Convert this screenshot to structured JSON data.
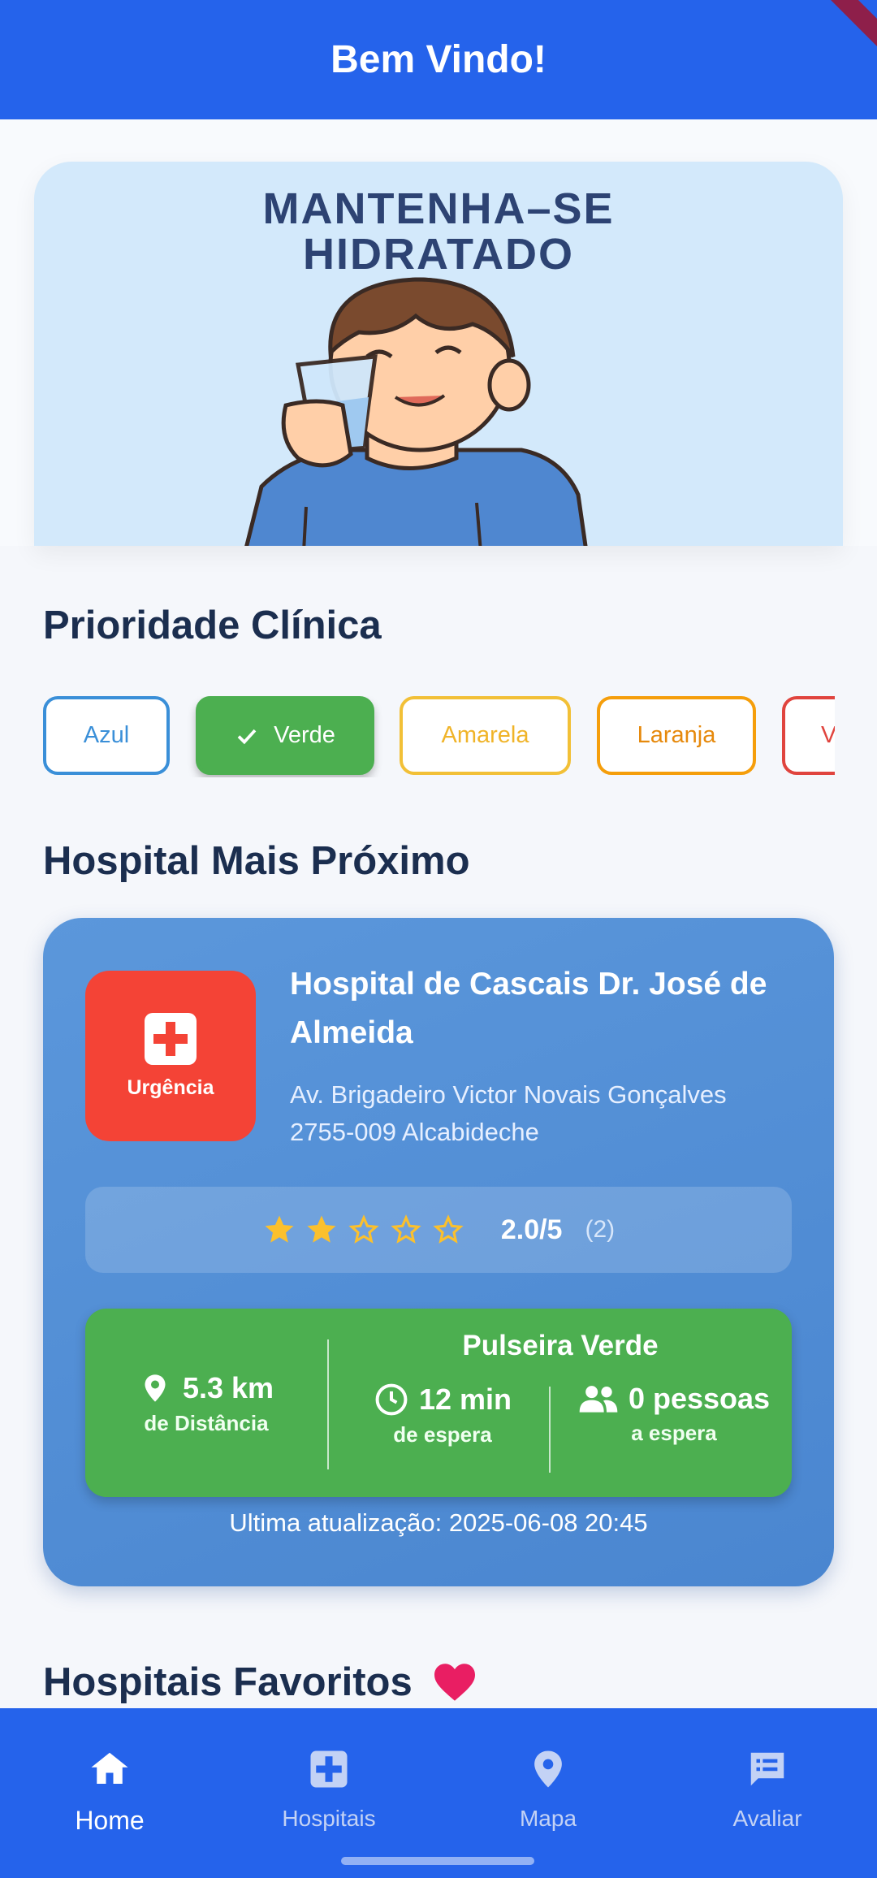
{
  "app_bar": {
    "title": "Bem Vindo!"
  },
  "banner": {
    "text": "MANTENHA–SE\nHIDRATADO"
  },
  "priority": {
    "title": "Prioridade Clínica",
    "chips": [
      {
        "label": "Azul",
        "selected": false,
        "color": "#3a8fd8"
      },
      {
        "label": "Verde",
        "selected": true,
        "color": "#4caf50"
      },
      {
        "label": "Amarela",
        "selected": false,
        "color": "#f2c037"
      },
      {
        "label": "Laranja",
        "selected": false,
        "color": "#f59e0b"
      },
      {
        "label": "V",
        "selected": false,
        "color": "#e0443e"
      }
    ]
  },
  "nearest": {
    "title": "Hospital Mais Próximo",
    "badge_label": "Urgência",
    "name": "Hospital de Cascais Dr. José de Almeida",
    "address": "Av. Brigadeiro Victor Novais Gonçalves 2755-009 Alcabideche",
    "rating": {
      "stars_filled": 2,
      "stars_total": 5,
      "value": "2.0/5",
      "count": "(2)"
    },
    "distance": {
      "value": "5.3 km",
      "label": "de Distância"
    },
    "bracelet": "Pulseira Verde",
    "wait": {
      "value": "12 min",
      "label": "de espera"
    },
    "people": {
      "value": "0 pessoas",
      "label": "a espera"
    },
    "updated": "Ultima atualização: 2025-06-08 20:45"
  },
  "favorites": {
    "title": "Hospitais Favoritos",
    "icon": "heart-icon"
  },
  "nav": {
    "items": [
      {
        "label": "Home",
        "icon": "home-icon",
        "active": true
      },
      {
        "label": "Hospitais",
        "icon": "hospital-icon",
        "active": false
      },
      {
        "label": "Mapa",
        "icon": "map-pin-icon",
        "active": false
      },
      {
        "label": "Avaliar",
        "icon": "feedback-icon",
        "active": false
      }
    ]
  },
  "colors": {
    "primary": "#2563eb",
    "success": "#4caf50",
    "danger": "#f44336",
    "card": "#5b97db",
    "heart": "#e91e63"
  }
}
